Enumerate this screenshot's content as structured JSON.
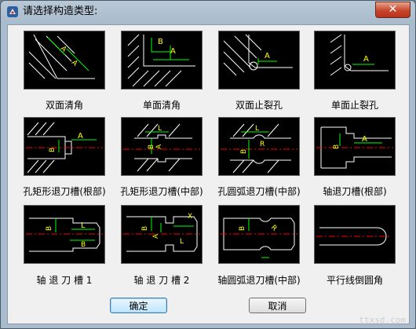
{
  "window": {
    "title": "请选择构造类型:",
    "close_glyph": "✕"
  },
  "options": [
    {
      "label": "双面清角",
      "icon": "double-chamfer"
    },
    {
      "label": "单面清角",
      "icon": "single-chamfer"
    },
    {
      "label": "双面止裂孔",
      "icon": "double-relief-hole"
    },
    {
      "label": "单面止裂孔",
      "icon": "single-relief-hole"
    },
    {
      "label": "孔矩形退刀槽(根部)",
      "icon": "hole-rect-undercut-root"
    },
    {
      "label": "孔矩形退刀槽(中部)",
      "icon": "hole-rect-undercut-middle"
    },
    {
      "label": "孔圆弧退刀槽(中部)",
      "icon": "hole-arc-undercut-middle"
    },
    {
      "label": "轴退刀槽(根部)",
      "icon": "shaft-undercut-root"
    },
    {
      "label": "轴 退 刀 槽 1",
      "icon": "shaft-undercut-1"
    },
    {
      "label": "轴 退 刀 槽 2",
      "icon": "shaft-undercut-2"
    },
    {
      "label": "轴圆弧退刀槽(中部)",
      "icon": "shaft-arc-undercut-middle"
    },
    {
      "label": "平行线倒圆角",
      "icon": "parallel-line-fillet"
    }
  ],
  "buttons": {
    "ok": "确定",
    "cancel": "取消"
  },
  "watermark": "ttxsd.com",
  "colors": {
    "title_bar": "#a9bccd",
    "close": "#c7452b",
    "thumb_bg": "#000000",
    "dim": "#00ff00",
    "annot": "#ffff00",
    "center": "#ff0000",
    "geometry": "#ffffff"
  }
}
